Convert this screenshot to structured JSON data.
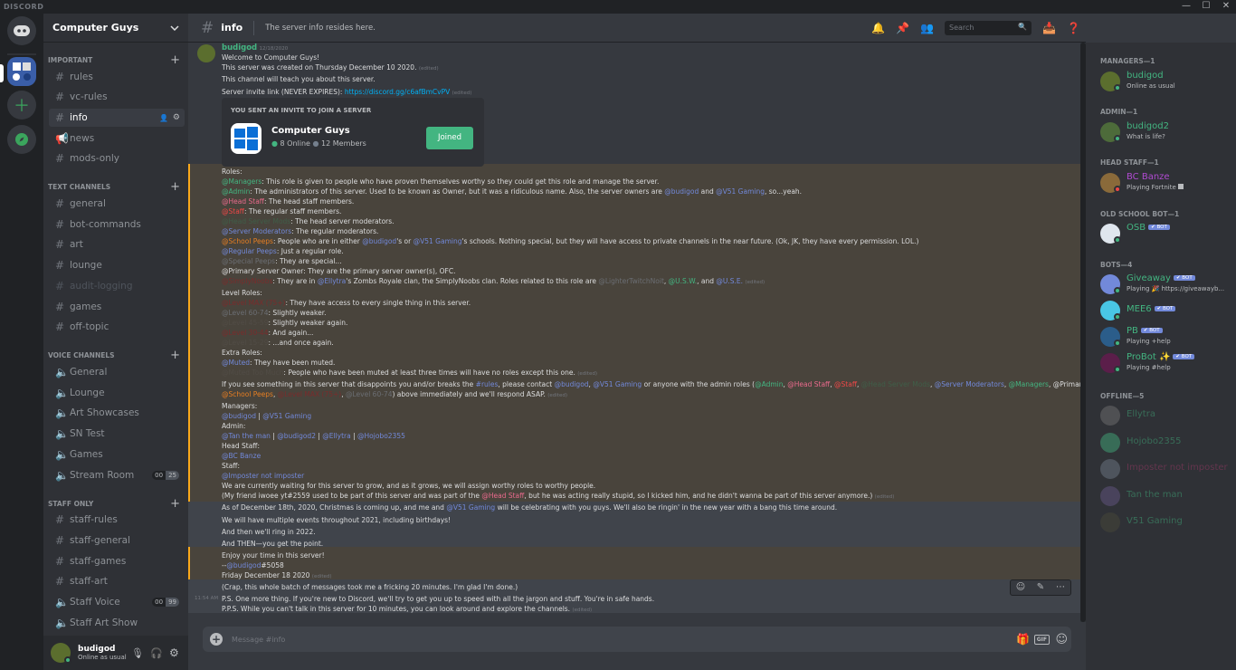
{
  "window": {
    "brand": "DISCORD",
    "min": "—",
    "max": "☐",
    "close": "✕"
  },
  "guild": {
    "name": "Computer Guys"
  },
  "categories": {
    "important": "IMPORTANT",
    "text": "TEXT CHANNELS",
    "voice": "VOICE CHANNELS",
    "staff": "STAFF ONLY"
  },
  "channels": {
    "important": [
      "rules",
      "vc-rules",
      "info",
      "news",
      "mods-only"
    ],
    "text": [
      "general",
      "bot-commands",
      "art",
      "lounge",
      "audit-logging",
      "games",
      "off-topic"
    ],
    "voice": [
      "General",
      "Lounge",
      "Art Showcases",
      "SN Test",
      "Games",
      "Stream Room"
    ],
    "staff": [
      "staff-rules",
      "staff-general",
      "staff-games",
      "staff-art",
      "Staff Voice",
      "Staff Art Show"
    ],
    "stream_counts": [
      "00",
      "25"
    ],
    "staff_voice_counts": [
      "00",
      "99"
    ]
  },
  "user": {
    "name": "budigod",
    "status": "Online as usual"
  },
  "header": {
    "channel": "info",
    "topic": "The server info resides here.",
    "search_placeholder": "Search"
  },
  "message": {
    "author": "budigod",
    "date": "12/18/2020",
    "time": "11:54 AM"
  },
  "invite": {
    "title": "YOU SENT AN INVITE TO JOIN A SERVER",
    "server": "Computer Guys",
    "online": "8 Online",
    "members": "12 Members",
    "button": "Joined"
  },
  "lines": {
    "l1": "Welcome to Computer Guys!",
    "l2": "This server was created on Thursday December 10 2020.",
    "l3": "This channel will teach you about this server.",
    "l4a": "Server invite link (NEVER EXPIRES): ",
    "l4b": "https://discord.gg/c6afBmCvPV",
    "edited": "(edited)",
    "roles": "Roles:",
    "r1a": "@Managers",
    "r1b": ": This role is given to people who have proven themselves worthy so they could get this role and manage the server.",
    "r2a": "@Admin",
    "r2b": ": The administrators of this server. Used to be known as Owner, but it was a ridiculous name. Also, the server owners are ",
    "r2c": "@budigod",
    "r2d": " and ",
    "r2e": "@V51 Gaming",
    "r2f": ", so...yeah.",
    "r3a": "@Head Staff",
    "r3b": ": The head staff members.",
    "r4a": "@Staff",
    "r4b": ": The regular staff members.",
    "r5a": "@Head Server Mods",
    "r5b": ": The head server moderators.",
    "r6a": "@Server Moderators",
    "r6b": ": The regular moderators.",
    "r7a": "@School Peeps",
    "r7b": ": People who are in either ",
    "r7c": "@budigod",
    "r7d": "'s or ",
    "r7e": "@V51 Gaming",
    "r7f": "'s schools. Nothing special, but they will have access to private channels in the near future. (Ok, JK, they have every permission. LOL.)",
    "r8a": "@Regular Peeps",
    "r8b": ": Just a regular role.",
    "r9a": "@Special Peeps",
    "r9b": ": They are special...",
    "r10": "@Primary Server Owner: They are the primary server owner(s), OFC.",
    "r11a": "@SimplyNoobs",
    "r11b": ": They are in ",
    "r11c": "@Ellytra",
    "r11d": "'s Zombs Royale clan, the SimplyNoobs clan. Roles related to this role are ",
    "r11e": "@LighterTwitchNoit",
    "r11f": ", ",
    "r11g": "@U.S.W.",
    "r11h": ", and ",
    "r11i": "@U.S.E.",
    "lv": "Level Roles:",
    "lv1a": "@Level MAX (75+)",
    "lv1b": ": They have access to every single thing in this server.",
    "lv2a": "@Level 60-74",
    "lv2b": ": Slightly weaker.",
    "lv3a": "@Level 45-59",
    "lv3b": ": Slightly weaker again.",
    "lv4a": "@Level 30-44",
    "lv4b": ": And again...",
    "lv5a": "@Level 15-29",
    "lv5b": ": ...and once again.",
    "ex": "Extra Roles:",
    "ex1a": "@Muted",
    "ex1b": ": They have been muted.",
    "ex2a": "@Muted Too Much",
    "ex2b": ": People who have been muted at least three times will have no roles except this one.",
    "rep1": "If you see something in this server that disappoints you and/or breaks the ",
    "rep2": "#rules",
    "rep3": ", please contact ",
    "rep4": "@budigod",
    "rep5": ", ",
    "rep6": "@V51 Gaming",
    "rep7": " or anyone with the admin roles (",
    "rep8": "@Admin",
    "rep9": ", ",
    "rep10": "@Head Staff",
    "rep11": ", ",
    "rep12": "@Staff",
    "rep13": ", ",
    "rep14": "@Head Server Mods",
    "rep15": ", ",
    "rep16": "@Server Moderators",
    "rep17": ", ",
    "rep18": "@Managers",
    "rep19": ", @Primary Server Owner,",
    "rep20": "@School Peeps",
    "rep21": ", ",
    "rep22": "@Level MAX (75+)",
    "rep23": ", ",
    "rep24": "@Level 60-74",
    "rep25": ") above immediately and we'll respond ASAP.",
    "mg": "Managers:",
    "mg1": "@budigod",
    "mg2": " | ",
    "mg3": "@V51 Gaming",
    "ad": "Admin:",
    "ad1": "@Tan the man",
    "ad2": " | ",
    "ad3": "@budigod2",
    "ad4": " | ",
    "ad5": "@Ellytra",
    "ad6": " | ",
    "ad7": "@Hojobo2355",
    "hs": "Head Staff:",
    "hs1": "@BC Banze",
    "st": "Staff:",
    "st1": "@Imposter not imposter",
    "gr1": "We are currently waiting for this server to grow, and as it grows, we will assign worthy roles to worthy people.",
    "gr2a": "(My friend iwoee yt#2559 used to be part of this server and was part of the ",
    "gr2b": "@Head Staff",
    "gr2c": ", but he was acting really stupid, so I kicked him, and he didn't wanna be part of this server anymore.)",
    "x1a": "As of December 18th, 2020, Christmas is coming up, and me and ",
    "x1b": "@V51 Gaming",
    "x1c": " will be celebrating with you guys. We'll also be ringin' in the new year with a bang this time around.",
    "x2": "We will have multiple events throughout 2021, including birthdays!",
    "x3": "And then we'll ring in 2022.",
    "x4": "And THEN—you get the point.",
    "e1": "Enjoy your time in this server!",
    "e2a": "--",
    "e2b": "@budigod",
    "e2c": "#5058",
    "e3": "Friday December 18 2020",
    "c1": "(Crap, this whole batch of messages took me a fricking 20 minutes. I'm glad I'm done.)",
    "c2": "P.S. One more thing. If you're new to Discord, we'll try to get you up to speed with all the jargon and stuff. You're in safe hands.",
    "c3": "P.P.S. While you can't talk in this server for 10 minutes, you can look around and explore the channels."
  },
  "composer": {
    "placeholder": "Message #info"
  },
  "members": {
    "cats": [
      "MANAGERS—1",
      "ADMIN—1",
      "HEAD STAFF—1",
      "OLD SCHOOL BOT—1",
      "BOTS—4",
      "OFFLINE—5"
    ],
    "list": [
      {
        "name": "budigod",
        "status": "Online as usual",
        "color": "#43b581"
      },
      {
        "name": "budigod2",
        "status": "What is life?",
        "color": "#43b581"
      },
      {
        "name": "BC Banze",
        "status": "Playing Fortnite",
        "color": "#b04bd1"
      },
      {
        "name": "OSB",
        "status": "",
        "color": "#43b581"
      },
      {
        "name": "Giveaway",
        "status": "Playing 🎉 https://giveawayb...",
        "color": "#43b581"
      },
      {
        "name": "MEE6",
        "status": "",
        "color": "#43b581"
      },
      {
        "name": "PB",
        "status": "Playing +help",
        "color": "#43b581"
      },
      {
        "name": "ProBot ✨",
        "status": "Playing #help",
        "color": "#43b581"
      },
      {
        "name": "Ellytra",
        "status": "",
        "color": "#3f6b52"
      },
      {
        "name": "Hojobo2355",
        "status": "",
        "color": "#3f6b52"
      },
      {
        "name": "Imposter not imposter",
        "status": "",
        "color": "#5a3a4a"
      },
      {
        "name": "Tan the man",
        "status": "",
        "color": "#3f6b52"
      },
      {
        "name": "V51 Gaming",
        "status": "",
        "color": "#3f6b52"
      }
    ],
    "bot_tag": "✔ BOT"
  }
}
